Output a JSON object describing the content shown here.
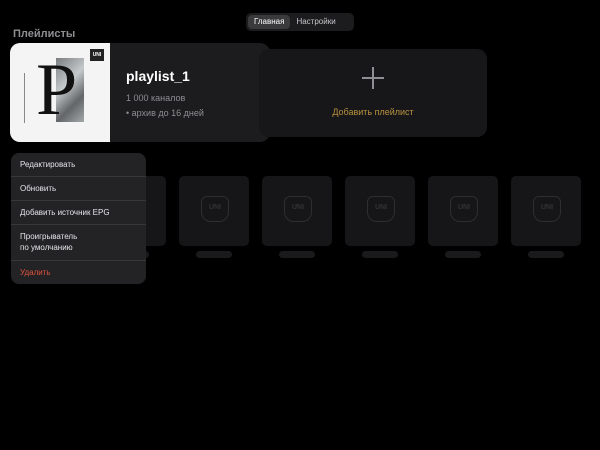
{
  "tabs": [
    {
      "label": "Главная",
      "active": true
    },
    {
      "label": "Настройки",
      "active": false
    }
  ],
  "section_title": "Плейлисты",
  "playlist": {
    "name": "playlist_1",
    "channels": "1 000 каналов",
    "archive": "• архив до 16 дней",
    "cover_logo": "UNI"
  },
  "add_playlist": {
    "label": "Добавить плейлист"
  },
  "channel_tiles": {
    "logo": "UNI",
    "count": 6
  },
  "context_menu": {
    "items": [
      {
        "label": "Редактировать"
      },
      {
        "label": "Обновить"
      },
      {
        "label": "Добавить источник EPG"
      },
      {
        "label_line1": "Проигрыватель",
        "label_line2": "по умолчанию"
      },
      {
        "label": "Удалить"
      }
    ]
  },
  "colors": {
    "background": "#000000",
    "card": "#1c1c1e",
    "accent_gold": "#b8913e",
    "danger": "#e0523f"
  }
}
